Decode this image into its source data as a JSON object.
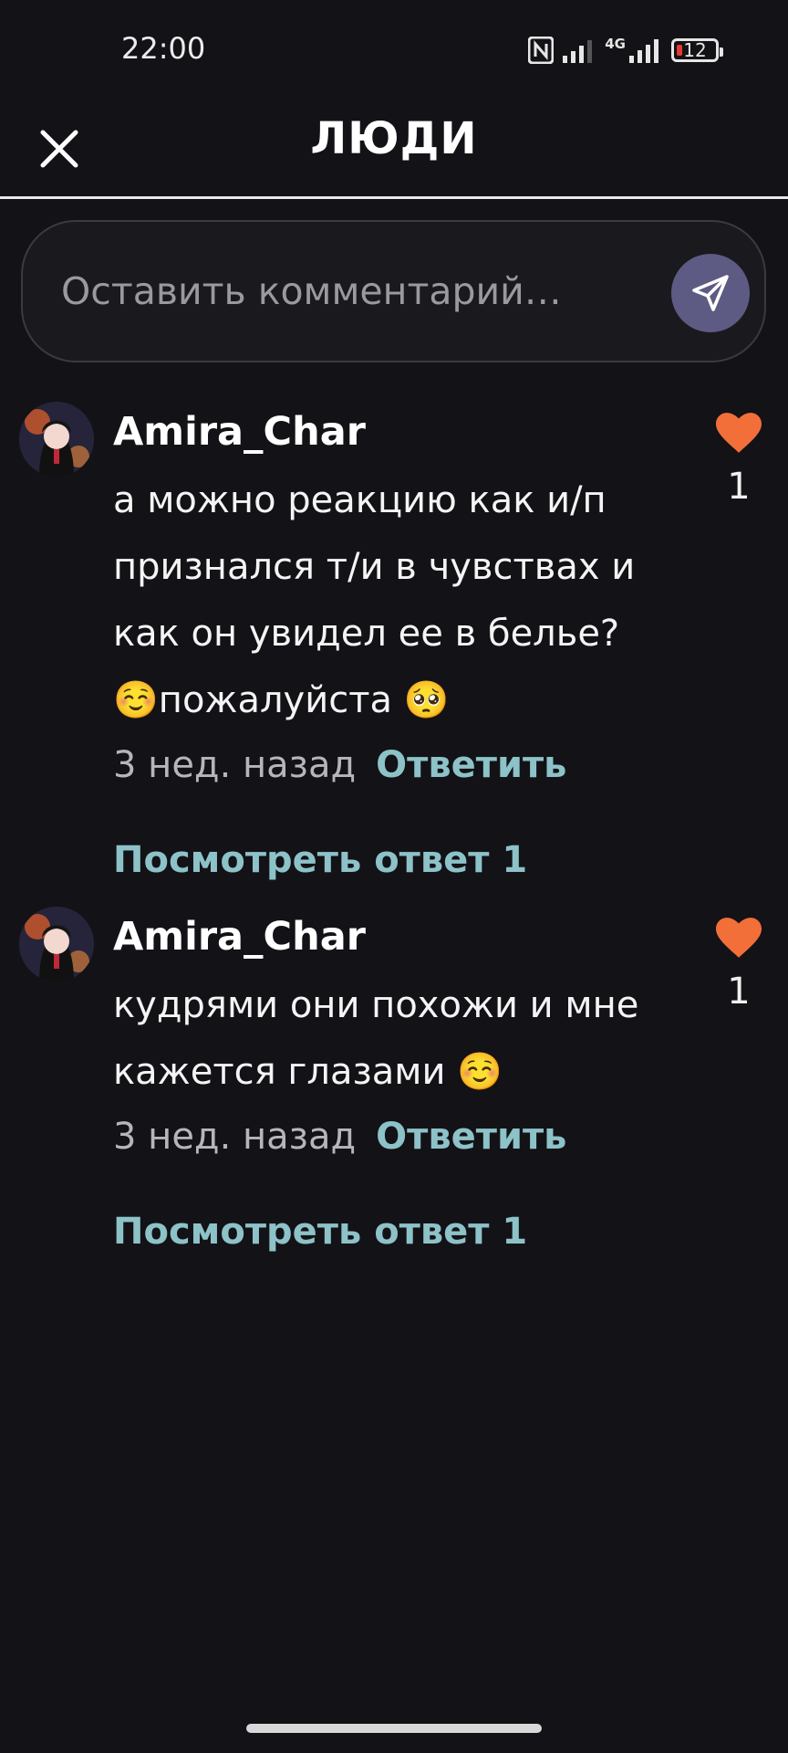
{
  "status": {
    "time": "22:00",
    "network": "4G",
    "battery": "12"
  },
  "header": {
    "title": "ЛЮДИ"
  },
  "comment_box": {
    "placeholder": "Оставить комментарий…"
  },
  "comments": [
    {
      "username": "Amira_Char",
      "text_lines": [
        "а можно реакцию  как и/п",
        "признался т/и в чувствах и",
        "как он увидел ее в белье?",
        "☺️пожалуйста 🥺"
      ],
      "time": "3 нед. назад",
      "reply_label": "Ответить",
      "likes": "1",
      "view_replies": "Посмотреть ответ 1"
    },
    {
      "username": "Amira_Char",
      "text_lines": [
        "кудрями они похожи и мне",
        "кажется глазами ☺️"
      ],
      "time": "3 нед. назад",
      "reply_label": "Ответить",
      "likes": "1",
      "view_replies": "Посмотреть ответ 1"
    }
  ],
  "colors": {
    "background": "#131216",
    "accent_link": "#8cc2c8",
    "like_heart": "#f26f3a",
    "send_button": "#5d5a84"
  }
}
